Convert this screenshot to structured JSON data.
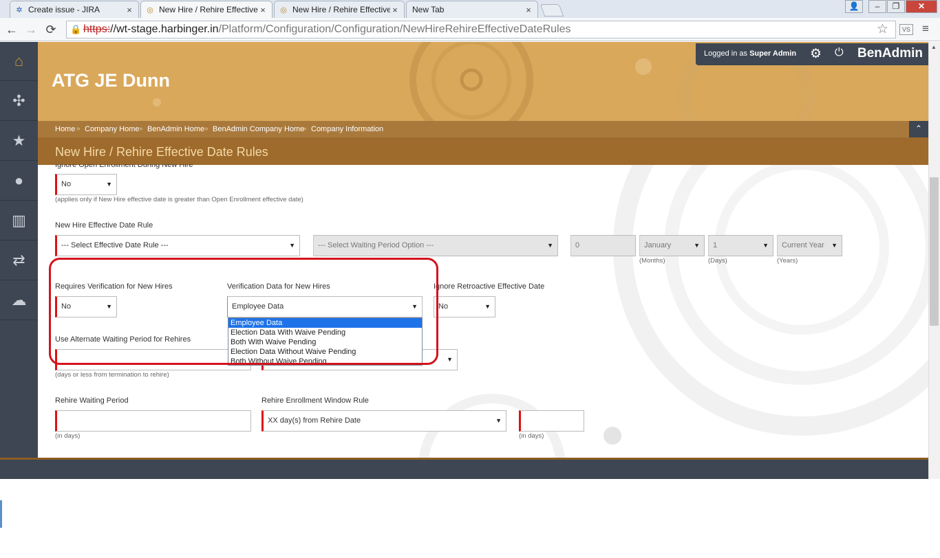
{
  "browser": {
    "tabs": [
      {
        "title": "Create issue - JIRA",
        "icon": "jira-icon"
      },
      {
        "title": "New Hire / Rehire Effective",
        "icon": "site-icon"
      },
      {
        "title": "New Hire / Rehire Effective",
        "icon": "site-icon"
      },
      {
        "title": "New Tab",
        "icon": ""
      }
    ],
    "url_proto": "https:",
    "url_host": "//wt-stage.harbinger.in",
    "url_path": "/Platform/Configuration/Configuration/NewHireRehireEffectiveDateRules"
  },
  "header": {
    "brand": "ATG JE Dunn",
    "logged_in_prefix": "Logged in as ",
    "user": "Super Admin",
    "app_name": "BenAdmin"
  },
  "breadcrumb": [
    "Home",
    "Company Home",
    "BenAdmin Home",
    "BenAdmin Company Home",
    "Company Information"
  ],
  "breadcrumb_sep": "»",
  "page_title": "New Hire / Rehire Effective Date Rules",
  "form": {
    "ignore_oe_label": "Ignore Open Enrollment During New Hire",
    "ignore_oe_value": "No",
    "ignore_oe_hint": "(applies only if New Hire effective date is greater than Open Enrollment effective date)",
    "nh_rule_label": "New Hire Effective Date Rule",
    "nh_rule_value": "--- Select Effective Date Rule ---",
    "waiting_option_value": "--- Select Waiting Period Option ---",
    "months_value": "0",
    "month_name_value": "January",
    "months_hint": "(Months)",
    "days_value": "1",
    "days_hint": "(Days)",
    "year_value": "Current Year",
    "years_hint": "(Years)",
    "req_verif_label": "Requires Verification for New Hires",
    "req_verif_value": "No",
    "verif_data_label": "Verification Data for New Hires",
    "verif_data_value": "Employee Data",
    "verif_options": [
      "Employee Data",
      "Election Data With Waive Pending",
      "Both With Waive Pending",
      "Election Data Without Waive Pending",
      "Both Without Waive Pending"
    ],
    "ignore_retro_label": "Ignore Retroactive Effective Date",
    "ignore_retro_value": "No",
    "alt_wait_label": "Use Alternate Waiting Period for Rehires",
    "alt_wait_hint": "(days or less from termination to rehire)",
    "rehire_wait_label": "Rehire Waiting Period",
    "rehire_wait_hint": "(in days)",
    "rehire_window_label": "Rehire Enrollment Window Rule",
    "rehire_window_value": "XX day(s) from Rehire Date",
    "rehire_window_hint": "(in days)"
  },
  "colors": {
    "accent_red": "#d4131c",
    "header_gold": "#d9a85a",
    "sidebar": "#3d4652",
    "highlight": "#1e73e8"
  }
}
